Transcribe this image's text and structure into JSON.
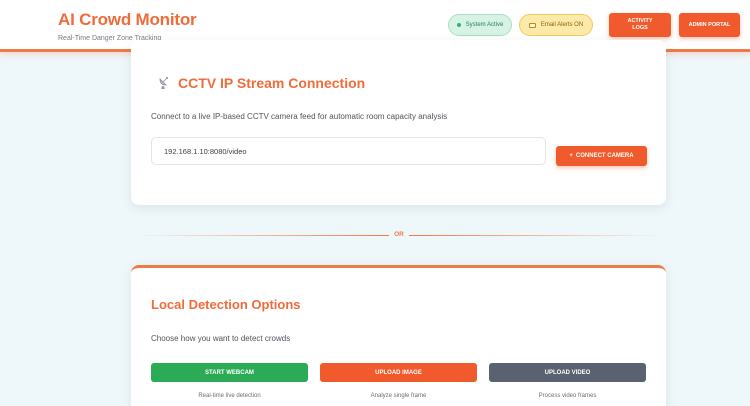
{
  "header": {
    "title": "AI Crowd Monitor",
    "subtitle": "Real-Time Danger Zone Tracking",
    "system_status": "System Active",
    "email_alerts": "Email Alerts ON",
    "activity_logs": "ACTIVITY LOGS",
    "admin_portal": "ADMIN PORTAL"
  },
  "cctv": {
    "title": "CCTV IP Stream Connection",
    "description": "Connect to a live IP-based CCTV camera feed for automatic room capacity analysis",
    "stream_url": "192.168.1.10:8080/video",
    "connect_label": "CONNECT CAMERA"
  },
  "divider": {
    "label": "OR"
  },
  "local": {
    "title": "Local Detection Options",
    "description": "Choose how you want to detect crowds",
    "options": [
      {
        "label": "START WEBCAM",
        "caption": "Real-time live detection"
      },
      {
        "label": "UPLOAD IMAGE",
        "caption": "Analyze single frame"
      },
      {
        "label": "UPLOAD VIDEO",
        "caption": "Process video frames"
      }
    ]
  },
  "colors": {
    "accent": "#f05a2c",
    "brand_text": "#ef6c3a",
    "success": "#2bab55",
    "secondary": "#5a6170",
    "background": "#eef7f9"
  },
  "icons": [
    "satellite-antenna-icon",
    "status-dot-icon",
    "mail-icon",
    "plus-icon"
  ]
}
